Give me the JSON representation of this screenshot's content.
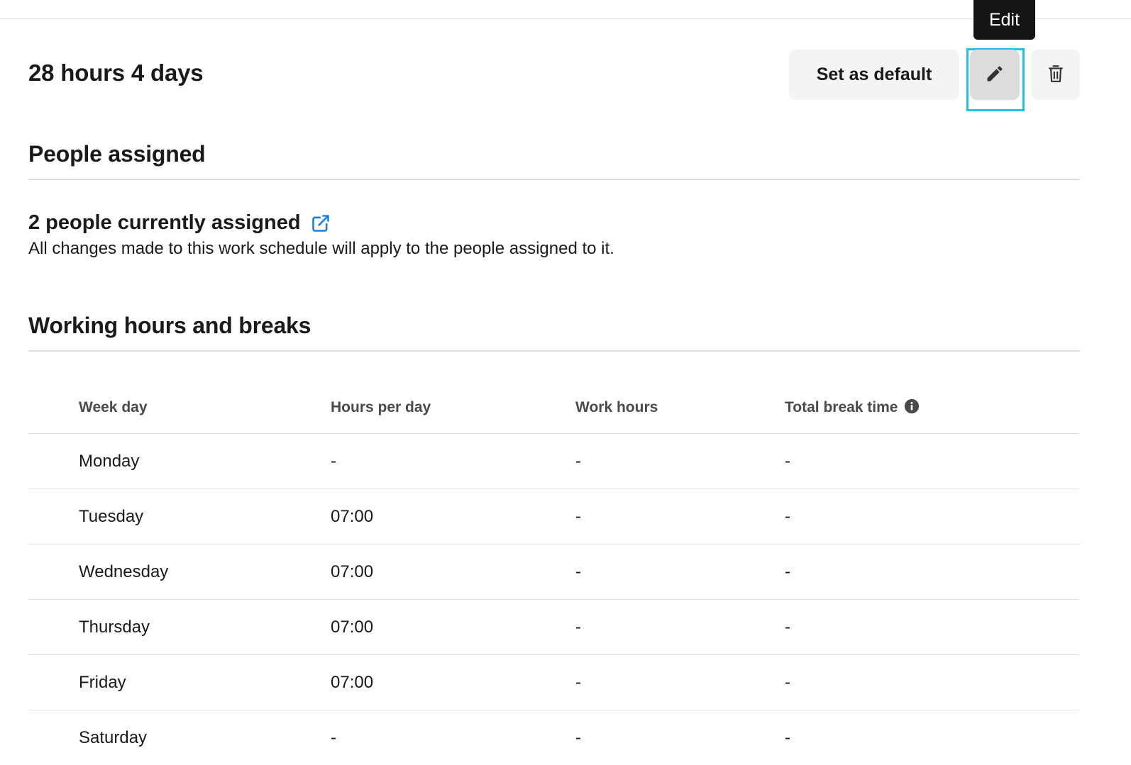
{
  "tooltip": {
    "text": "Edit"
  },
  "header": {
    "title": "28 hours 4 days",
    "set_default_label": "Set as default",
    "edit_icon": "pencil-icon",
    "delete_icon": "trash-icon"
  },
  "people": {
    "section_title": "People assigned",
    "assigned_title": "2 people currently assigned",
    "link_icon": "external-link-icon",
    "description": "All changes made to this work schedule will apply to the people assigned to it."
  },
  "hours": {
    "section_title": "Working hours and breaks",
    "columns": [
      "Week day",
      "Hours per day",
      "Work hours",
      "Total break time"
    ],
    "info_icon": "info-icon",
    "rows": [
      {
        "day": "Monday",
        "hours_per_day": "-",
        "work_hours": "-",
        "break_time": "-"
      },
      {
        "day": "Tuesday",
        "hours_per_day": "07:00",
        "work_hours": "-",
        "break_time": "-"
      },
      {
        "day": "Wednesday",
        "hours_per_day": "07:00",
        "work_hours": "-",
        "break_time": "-"
      },
      {
        "day": "Thursday",
        "hours_per_day": "07:00",
        "work_hours": "-",
        "break_time": "-"
      },
      {
        "day": "Friday",
        "hours_per_day": "07:00",
        "work_hours": "-",
        "break_time": "-"
      },
      {
        "day": "Saturday",
        "hours_per_day": "-",
        "work_hours": "-",
        "break_time": "-"
      }
    ]
  },
  "colors": {
    "focus_ring": "#22c0e8",
    "link": "#1a7fe0",
    "tooltip_bg": "#141414"
  }
}
